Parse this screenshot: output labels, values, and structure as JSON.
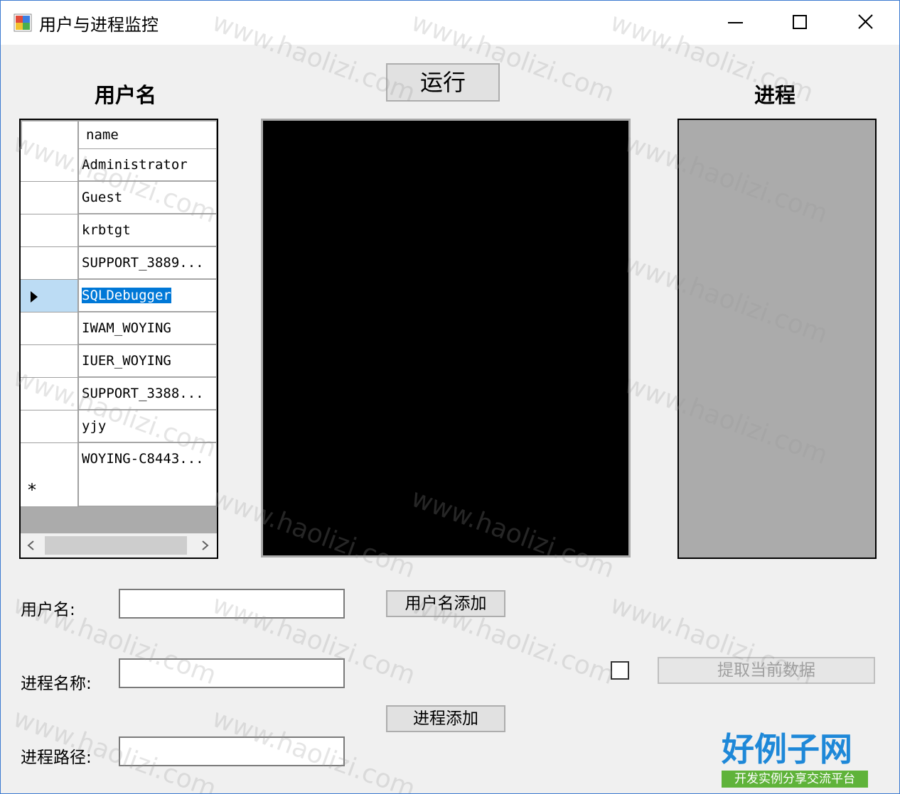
{
  "window": {
    "title": "用户与进程监控",
    "minimize_icon": "minimize-icon",
    "maximize_icon": "maximize-icon",
    "close_icon": "close-icon"
  },
  "headings": {
    "users": "用户名",
    "processes": "进程"
  },
  "toolbar": {
    "run_label": "运行"
  },
  "users_grid": {
    "column_header": "name",
    "rows": [
      "Administrator",
      "Guest",
      "krbtgt",
      "SUPPORT_3889...",
      "SQLDebugger",
      "IWAM_WOYING",
      "IUER_WOYING",
      "SUPPORT_3388...",
      "yjy",
      "WOYING-C8443..."
    ],
    "selected_index": 4,
    "new_row_marker": "*",
    "scroll_left_icon": "chevron-left-icon",
    "scroll_right_icon": "chevron-right-icon"
  },
  "form": {
    "username_label": "用户名:",
    "username_value": "",
    "add_user_label": "用户名添加",
    "process_name_label": "进程名称:",
    "process_name_value": "",
    "process_path_label": "进程路径:",
    "process_path_value": "",
    "add_process_label": "进程添加",
    "fetch_label": "提取当前数据",
    "fetch_checked": false
  },
  "watermark": {
    "text": "www.haolizi.com",
    "logo_text": "好例子网",
    "logo_subtext": "开发实例分享交流平台"
  },
  "colors": {
    "selection": "#0078d7",
    "row_header_selected": "#bcdcf4",
    "logo_blue": "#1e88d8",
    "logo_green": "#5fb33a"
  }
}
